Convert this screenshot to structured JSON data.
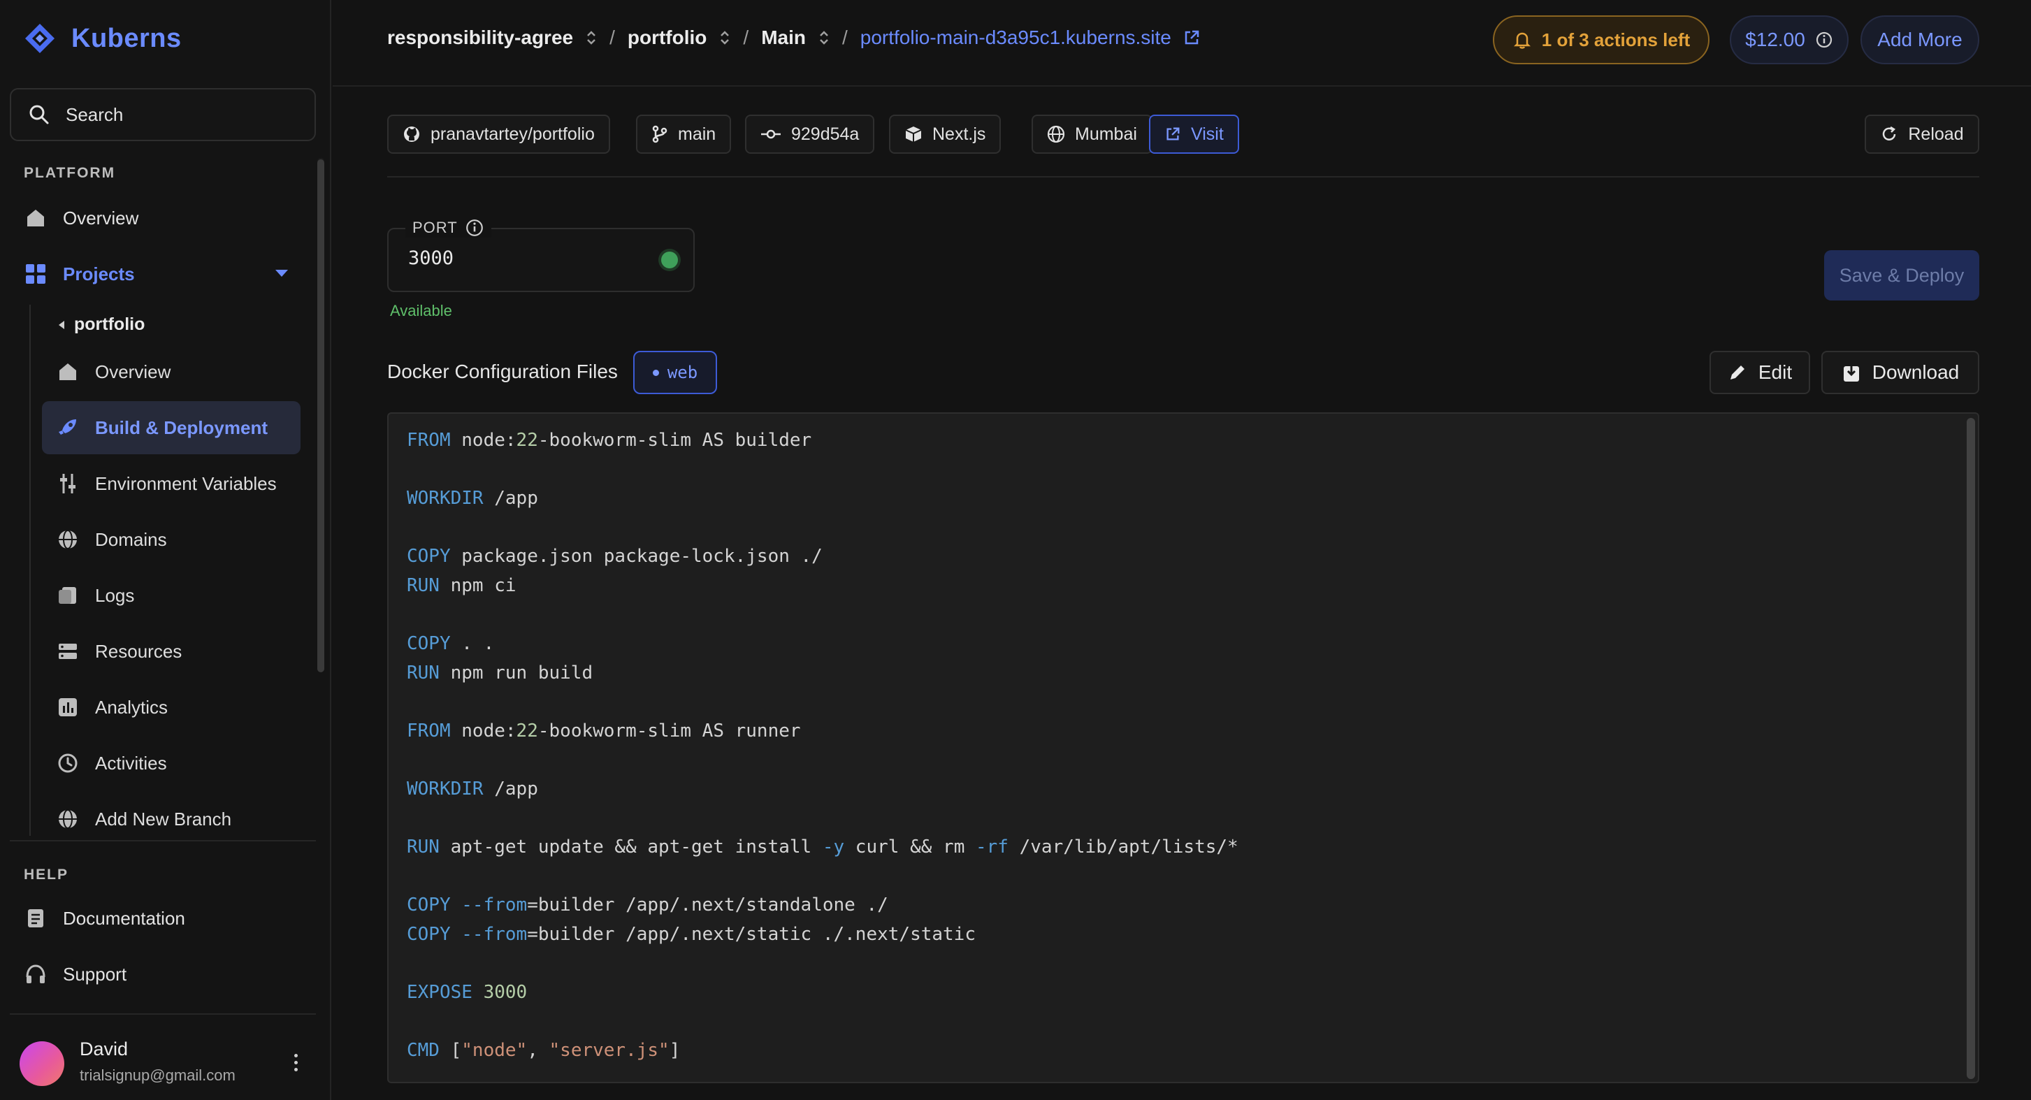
{
  "app": {
    "name": "Kuberns"
  },
  "sidebar": {
    "search_label": "Search",
    "platform_label": "PLATFORM",
    "overview": "Overview",
    "projects": "Projects",
    "project_name": "portfolio",
    "sub_items": [
      {
        "label": "Overview",
        "icon": "home-icon"
      },
      {
        "label": "Build & Deployment",
        "icon": "rocket-icon",
        "selected": true
      },
      {
        "label": "Environment Variables",
        "icon": "sliders-icon"
      },
      {
        "label": "Domains",
        "icon": "globe-icon"
      },
      {
        "label": "Logs",
        "icon": "logs-icon"
      },
      {
        "label": "Resources",
        "icon": "server-icon"
      },
      {
        "label": "Analytics",
        "icon": "chart-icon"
      },
      {
        "label": "Activities",
        "icon": "history-icon"
      },
      {
        "label": "Add New Branch",
        "icon": "globe-icon"
      }
    ],
    "help_label": "HELP",
    "documentation": "Documentation",
    "support": "Support",
    "user": {
      "name": "David",
      "email": "trialsignup@gmail.com"
    }
  },
  "topbar": {
    "crumbs": [
      "responsibility-agree",
      "portfolio",
      "Main"
    ],
    "separator": "/",
    "site_link": "portfolio-main-d3a95c1.kuberns.site",
    "actions_left": "1 of 3 actions left",
    "price": "$12.00",
    "add_more": "Add More"
  },
  "chips": {
    "repo": "pranavtartey/portfolio",
    "branch": "main",
    "commit": "929d54a",
    "framework": "Next.js",
    "region": "Mumbai",
    "visit": "Visit",
    "reload": "Reload"
  },
  "port": {
    "label": "PORT",
    "value": "3000",
    "status": "Available"
  },
  "save_deploy": "Save & Deploy",
  "docker": {
    "title": "Docker Configuration Files",
    "tag": "web",
    "edit": "Edit",
    "download": "Download",
    "lines": [
      {
        "kw": "FROM",
        "rest": " node:22-bookworm-slim AS builder"
      },
      {
        "kw": "WORKDIR",
        "rest": " /app"
      },
      {
        "kw": "COPY",
        "rest": " package.json package-lock.json ./"
      },
      {
        "kw": "RUN",
        "rest": " npm ci"
      },
      {
        "kw": "COPY",
        "rest": " . ."
      },
      {
        "kw": "RUN",
        "rest": " npm run build"
      },
      {
        "kw": "FROM",
        "rest": " node:22-bookworm-slim AS runner"
      },
      {
        "kw": "WORKDIR",
        "rest": " /app"
      },
      {
        "kw": "RUN",
        "rest": " apt-get update && apt-get install -y curl && rm -rf /var/lib/apt/lists/*"
      },
      {
        "kw": "COPY",
        "rest": " --from=builder /app/.next/standalone ./"
      },
      {
        "kw": "COPY",
        "rest": " --from=builder /app/.next/static ./.next/static"
      },
      {
        "kw": "EXPOSE",
        "rest": " 3000"
      },
      {
        "kw": "CMD",
        "rest": " [\"node\", \"server.js\"]"
      }
    ]
  },
  "colors": {
    "accent": "#6b8bff",
    "warning": "#e3a23a",
    "success": "#5fbf6a",
    "background": "#131313"
  }
}
